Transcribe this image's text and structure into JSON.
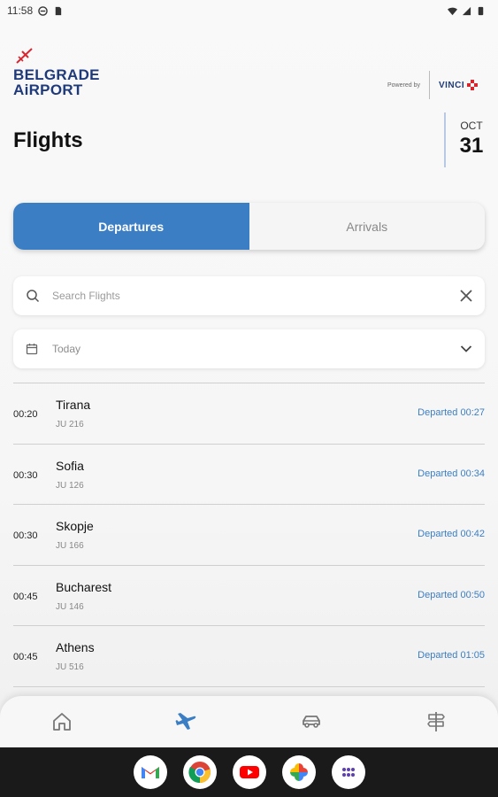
{
  "status_bar": {
    "time": "11:58"
  },
  "header": {
    "logo_line1": "BELGRADE",
    "logo_line2": "AiRPORT",
    "powered_by": "Powered by",
    "vinci": "VINCI",
    "title": "Flights",
    "date_month": "OCT",
    "date_day": "31"
  },
  "tabs": [
    {
      "label": "Departures",
      "active": true
    },
    {
      "label": "Arrivals",
      "active": false
    }
  ],
  "search": {
    "placeholder": "Search Flights",
    "value": ""
  },
  "date_filter": {
    "value": "Today"
  },
  "flights": [
    {
      "time": "00:20",
      "city": "Tirana",
      "flight": "JU 216",
      "status": "Departed 00:27"
    },
    {
      "time": "00:30",
      "city": "Sofia",
      "flight": "JU 126",
      "status": "Departed 00:34"
    },
    {
      "time": "00:30",
      "city": "Skopje",
      "flight": "JU 166",
      "status": "Departed 00:42"
    },
    {
      "time": "00:45",
      "city": "Bucharest",
      "flight": "JU 146",
      "status": "Departed 00:50"
    },
    {
      "time": "00:45",
      "city": "Athens",
      "flight": "JU 516",
      "status": "Departed 01:05"
    }
  ],
  "bottom_nav": [
    {
      "icon": "home-icon",
      "active": false
    },
    {
      "icon": "plane-icon",
      "active": true
    },
    {
      "icon": "car-icon",
      "active": false
    },
    {
      "icon": "signpost-icon",
      "active": false
    }
  ],
  "system_apps": [
    "gmail-icon",
    "chrome-icon",
    "youtube-icon",
    "photos-icon",
    "app-drawer-icon"
  ],
  "colors": {
    "accent": "#3b7ec4",
    "brand": "#1f3a7a",
    "status": "#3b7ec4"
  }
}
